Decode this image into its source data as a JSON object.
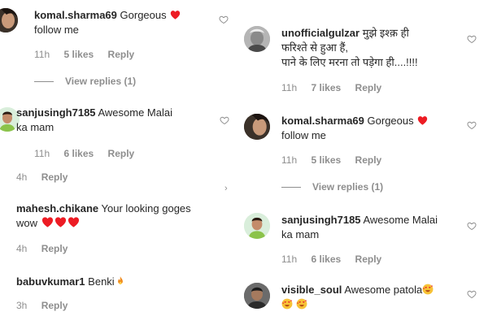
{
  "left": {
    "c1": {
      "username": "komal.sharma69",
      "text": "Gorgeous",
      "text2": "follow me",
      "time": "11h",
      "likes": "5 likes",
      "reply": "Reply",
      "view_replies": "View replies (1)"
    },
    "c2": {
      "username": "sanjusingh7185",
      "text": "Awesome Malai",
      "text2": "ka mam",
      "time": "11h",
      "likes": "6 likes",
      "reply": "Reply"
    },
    "r2": {
      "time": "4h",
      "reply": "Reply"
    },
    "c3": {
      "username": "mahesh.chikane",
      "text": "Your looking goges",
      "text2": "wow",
      "time": "4h",
      "reply": "Reply"
    },
    "c4": {
      "username": "babuvkumar1",
      "text": "Benki",
      "time": "3h",
      "reply": "Reply"
    }
  },
  "right": {
    "c1": {
      "username": "unofficialgulzar",
      "text": "मुझे इश्क़ ही",
      "text2": "फरिश्ते से हुआ हैं,",
      "text3": "पाने के लिए मरना तो पड़ेगा ही....!!!!",
      "time": "11h",
      "likes": "7 likes",
      "reply": "Reply"
    },
    "c2": {
      "username": "komal.sharma69",
      "text": "Gorgeous",
      "text2": "follow me",
      "time": "11h",
      "likes": "5 likes",
      "reply": "Reply",
      "view_replies": "View replies (1)"
    },
    "c3": {
      "username": "sanjusingh7185",
      "text": "Awesome Malai",
      "text2": "ka mam",
      "time": "11h",
      "likes": "6 likes",
      "reply": "Reply"
    },
    "c4": {
      "username": "visible_soul",
      "text": "Awesome patola"
    }
  },
  "colors": {
    "heart": "#ed1c24",
    "meta": "#8e8e8e",
    "text": "#262626"
  },
  "icons": {
    "like": "heart-outline-icon",
    "nav": "chevron-right-icon"
  }
}
